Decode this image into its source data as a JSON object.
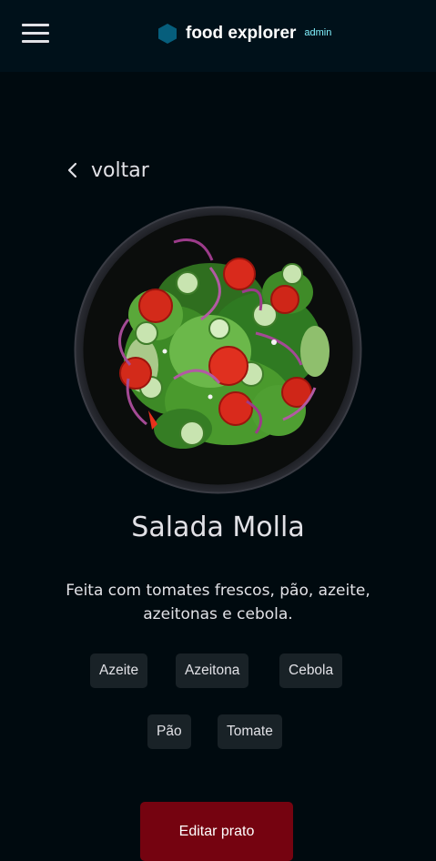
{
  "header": {
    "menu_icon": "hamburger-menu-icon",
    "brand_icon": "hexagon-logo-icon",
    "brand_name": "food explorer",
    "brand_badge": "admin"
  },
  "nav": {
    "back_icon": "chevron-left-icon",
    "back_label": "voltar"
  },
  "dish": {
    "image_alt": "salad-bowl-image",
    "title": "Salada Molla",
    "description": "Feita com tomates frescos, pão, azeite, azeitonas e cebola.",
    "ingredients": [
      "Azeite",
      "Azeitona",
      "Cebola",
      "Pão",
      "Tomate"
    ]
  },
  "actions": {
    "edit_label": "Editar prato"
  },
  "colors": {
    "background": "#000a0f",
    "header_bg": "#00111a",
    "tag_bg": "#192227",
    "button_bg": "#750310",
    "brand_icon": "#065e7c",
    "badge_text": "#82f3ff"
  }
}
